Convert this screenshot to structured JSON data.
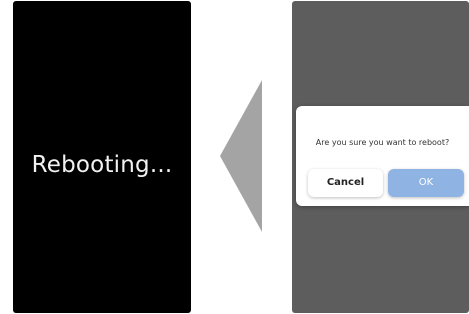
{
  "left_screen": {
    "status_text": "Rebooting..."
  },
  "transition_arrow": {
    "icon": "left-arrow-icon",
    "color": "#a4a4a4"
  },
  "right_screen": {
    "dialog": {
      "message": "Are you sure you want to reboot?",
      "cancel_label": "Cancel",
      "ok_label": "OK"
    }
  },
  "colors": {
    "left_screen_bg": "#000000",
    "right_screen_overlay": "#5d5d5d",
    "ok_button": "#8fb4e3"
  }
}
